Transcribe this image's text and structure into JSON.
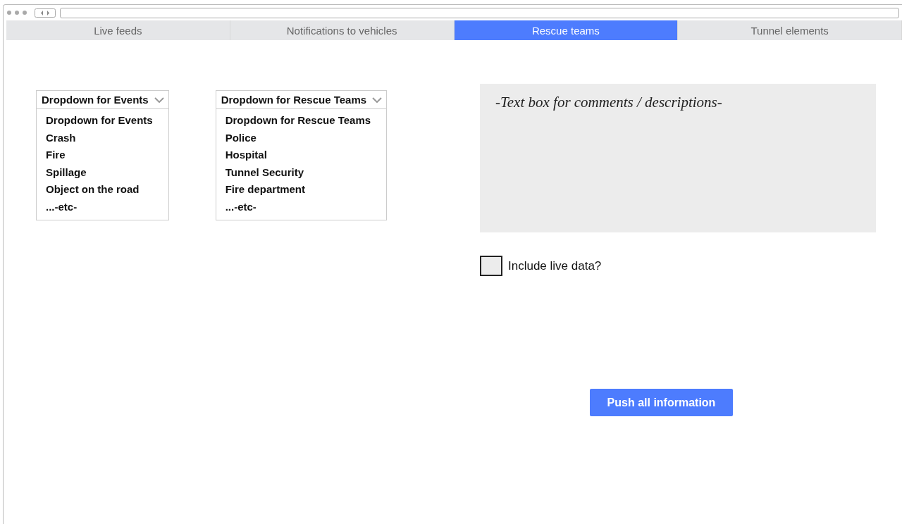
{
  "tabs": [
    {
      "label": "Live feeds",
      "selected": false
    },
    {
      "label": "Notifications to vehicles",
      "selected": false
    },
    {
      "label": "Rescue teams",
      "selected": true
    },
    {
      "label": "Tunnel elements",
      "selected": false
    }
  ],
  "dropdowns": [
    {
      "header": "Dropdown for Events",
      "options": [
        "Dropdown for Events",
        "Crash",
        "Fire",
        "Spillage",
        "Object on the road",
        "...-etc-"
      ]
    },
    {
      "header": "Dropdown for Rescue Teams",
      "options": [
        "Dropdown for Rescue Teams",
        "Police",
        "Hospital",
        "Tunnel Security",
        "Fire department",
        "...-etc-"
      ]
    }
  ],
  "comments": {
    "placeholder": "-Text box for comments / descriptions-"
  },
  "live_data": {
    "label": "Include live data?",
    "checked": false
  },
  "push_button": "Push all information"
}
